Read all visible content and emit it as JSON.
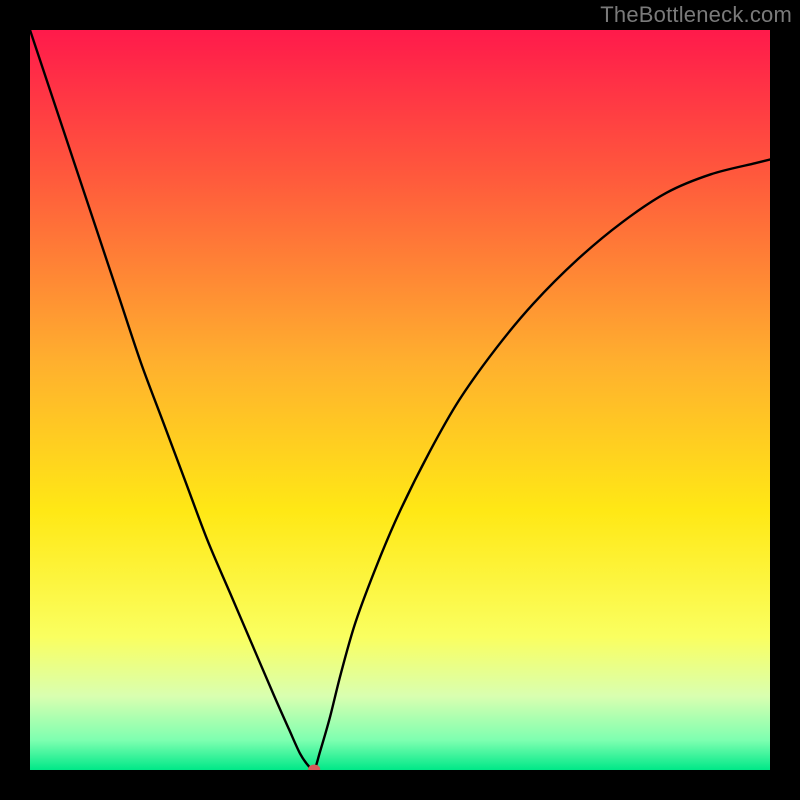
{
  "watermark": "TheBottleneck.com",
  "chart_data": {
    "type": "line",
    "title": "",
    "xlabel": "",
    "ylabel": "",
    "xlim": [
      0,
      100
    ],
    "ylim": [
      0,
      100
    ],
    "grid": false,
    "legend": false,
    "background_gradient": {
      "stops": [
        {
          "pos": 0.0,
          "color": "#ff1a4b"
        },
        {
          "pos": 0.2,
          "color": "#ff5a3c"
        },
        {
          "pos": 0.45,
          "color": "#ffb02e"
        },
        {
          "pos": 0.65,
          "color": "#ffe815"
        },
        {
          "pos": 0.82,
          "color": "#faff60"
        },
        {
          "pos": 0.9,
          "color": "#d9ffb0"
        },
        {
          "pos": 0.96,
          "color": "#7dffb0"
        },
        {
          "pos": 1.0,
          "color": "#00e888"
        }
      ]
    },
    "series": [
      {
        "name": "bottleneck-curve",
        "color": "#000000",
        "x": [
          0,
          3,
          6,
          9,
          12,
          15,
          18,
          21,
          24,
          27,
          30,
          33,
          35,
          36.5,
          37.6,
          38.4,
          39.2,
          40.5,
          42,
          44,
          47,
          50,
          54,
          58,
          63,
          68,
          74,
          80,
          86,
          92,
          98,
          100
        ],
        "y": [
          100,
          91,
          82,
          73,
          64,
          55,
          47,
          39,
          31,
          24,
          17,
          10,
          5.5,
          2.2,
          0.6,
          0,
          2.5,
          7,
          13,
          20,
          28,
          35,
          43,
          50,
          57,
          63,
          69,
          74,
          78,
          80.5,
          82,
          82.5
        ]
      }
    ],
    "marker": {
      "name": "optimal-point",
      "x": 38.4,
      "y": 0,
      "color": "#d85a5a",
      "rx": 6,
      "ry": 4.5
    }
  }
}
